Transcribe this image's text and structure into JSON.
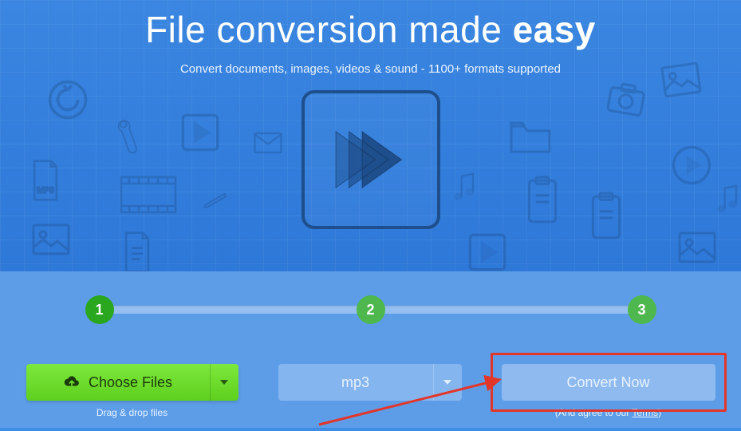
{
  "hero": {
    "title_prefix": "File conversion made ",
    "title_bold": "easy",
    "subtitle": "Convert documents, images, videos & sound - 1100+ formats supported"
  },
  "steps": {
    "s1": "1",
    "s2": "2",
    "s3": "3"
  },
  "controls": {
    "choose_files_label": "Choose Files",
    "drag_drop_hint": "Drag & drop files",
    "format_selected": "mp3",
    "convert_label": "Convert Now",
    "terms_prefix": "(And agree to our ",
    "terms_link": "Terms",
    "terms_suffix": ")"
  }
}
